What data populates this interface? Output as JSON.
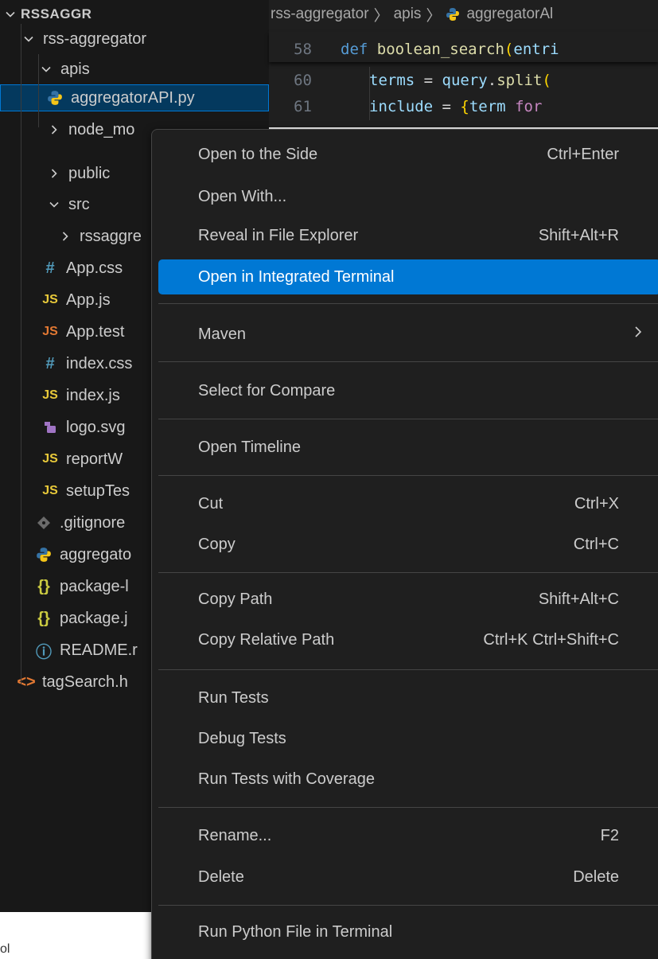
{
  "explorer": {
    "section_title": "RSSAGGR",
    "items": [
      {
        "label": "rss-aggregator",
        "kind": "folder-open"
      },
      {
        "label": "apis",
        "kind": "folder-open"
      },
      {
        "label": "aggregatorAPI.py",
        "kind": "python"
      },
      {
        "label": "node_mo",
        "kind": "folder-closed"
      },
      {
        "label": "public",
        "kind": "folder-closed"
      },
      {
        "label": "src",
        "kind": "folder-open"
      },
      {
        "label": "rssaggre",
        "kind": "folder-closed"
      },
      {
        "label": "App.css",
        "kind": "css"
      },
      {
        "label": "App.js",
        "kind": "js"
      },
      {
        "label": "App.test",
        "kind": "js-test"
      },
      {
        "label": "index.css",
        "kind": "css"
      },
      {
        "label": "index.js",
        "kind": "js"
      },
      {
        "label": "logo.svg",
        "kind": "svg"
      },
      {
        "label": "reportW",
        "kind": "js"
      },
      {
        "label": "setupTes",
        "kind": "js"
      },
      {
        "label": ".gitignore",
        "kind": "git"
      },
      {
        "label": "aggregato",
        "kind": "python"
      },
      {
        "label": "package-l",
        "kind": "json"
      },
      {
        "label": "package.j",
        "kind": "json"
      },
      {
        "label": "README.r",
        "kind": "info"
      },
      {
        "label": "tagSearch.h",
        "kind": "html"
      }
    ]
  },
  "icons": {
    "css": "#",
    "js": "JS",
    "json": "{}",
    "html": "<>",
    "info": "ⓘ"
  },
  "colors": {
    "sidebar_bg": "#181818",
    "editor_bg": "#1f1f1f",
    "menu_bg": "#1f1f1f",
    "highlight": "#0078d4",
    "selected_row": "#04395e",
    "python_blue": "#3572a5",
    "python_yellow": "#f5c518",
    "js_yellow": "#e8c93a",
    "css_blue": "#519aba",
    "json_yellow": "#cbcb41",
    "svg_purple": "#a074c4",
    "html_orange": "#e37933"
  },
  "editor": {
    "breadcrumb": [
      "rss-aggregator",
      "apis",
      "aggregatorAl"
    ],
    "lines": [
      {
        "num": "58",
        "parts": [
          [
            "kw",
            "def "
          ],
          [
            "fn",
            "boolean_search"
          ],
          [
            "br",
            "("
          ],
          [
            "var",
            "entri"
          ]
        ]
      },
      {
        "num": "60",
        "parts": [
          [
            "var",
            "terms"
          ],
          [
            "op",
            " = "
          ],
          [
            "var",
            "query"
          ],
          [
            "op",
            "."
          ],
          [
            "fn",
            "split"
          ],
          [
            "br",
            "("
          ]
        ]
      },
      {
        "num": "61",
        "parts": [
          [
            "var",
            "include"
          ],
          [
            "op",
            " = "
          ],
          [
            "br",
            "{"
          ],
          [
            "var",
            "term"
          ],
          [
            "kw2",
            " for"
          ]
        ]
      }
    ]
  },
  "context_menu": {
    "items": [
      {
        "label": "Open to the Side",
        "shortcut": "Ctrl+Enter"
      },
      {
        "label": "Open With...",
        "shortcut": ""
      },
      {
        "label": "Reveal in File Explorer",
        "shortcut": "Shift+Alt+R"
      },
      {
        "label": "Open in Integrated Terminal",
        "shortcut": "",
        "highlighted": true
      },
      {
        "label": "Maven",
        "shortcut": "",
        "submenu": true
      },
      {
        "label": "Select for Compare",
        "shortcut": ""
      },
      {
        "label": "Open Timeline",
        "shortcut": ""
      },
      {
        "label": "Cut",
        "shortcut": "Ctrl+X"
      },
      {
        "label": "Copy",
        "shortcut": "Ctrl+C"
      },
      {
        "label": "Copy Path",
        "shortcut": "Shift+Alt+C"
      },
      {
        "label": "Copy Relative Path",
        "shortcut": "Ctrl+K Ctrl+Shift+C"
      },
      {
        "label": "Run Tests",
        "shortcut": ""
      },
      {
        "label": "Debug Tests",
        "shortcut": ""
      },
      {
        "label": "Run Tests with Coverage",
        "shortcut": ""
      },
      {
        "label": "Rename...",
        "shortcut": "F2"
      },
      {
        "label": "Delete",
        "shortcut": "Delete"
      },
      {
        "label": "Run Python File in Terminal",
        "shortcut": ""
      }
    ]
  },
  "corner_text": "ol"
}
